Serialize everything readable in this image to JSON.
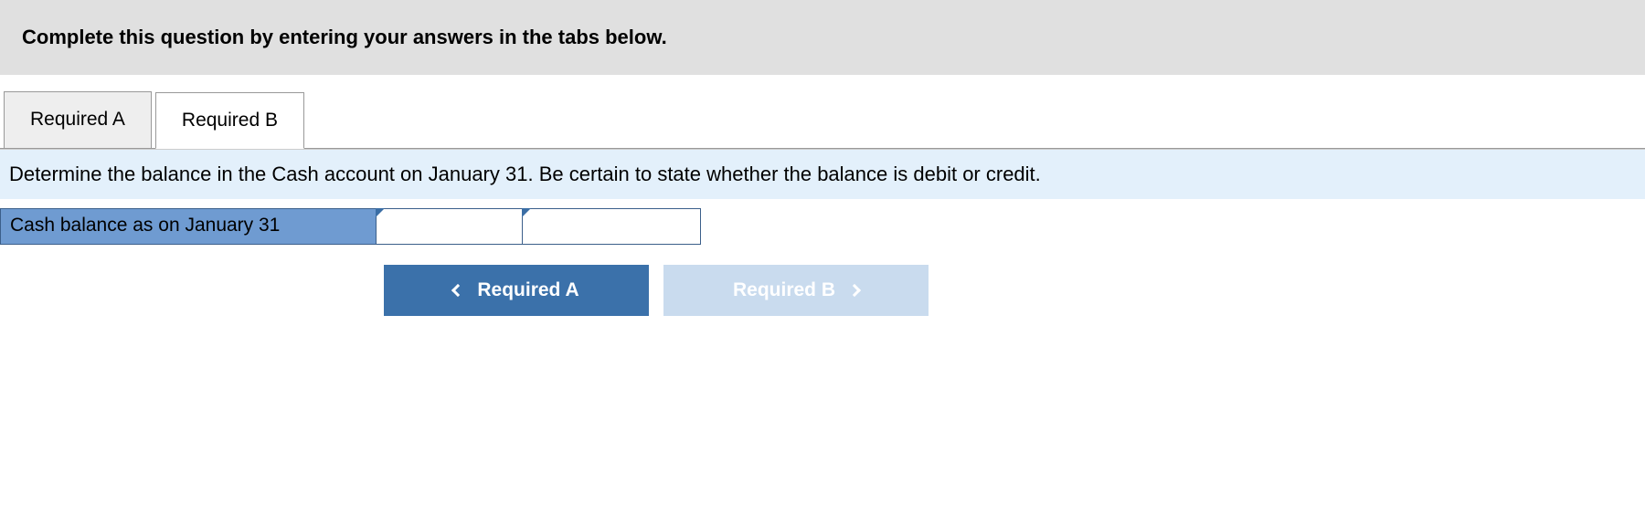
{
  "instruction": "Complete this question by entering your answers in the tabs below.",
  "tabs": [
    {
      "label": "Required A",
      "active": false
    },
    {
      "label": "Required B",
      "active": true
    }
  ],
  "question": "Determine the balance in the Cash account on January 31. Be certain to state whether the balance is debit or credit.",
  "answer_row": {
    "label": "Cash balance as on January 31",
    "input1_value": "",
    "input2_value": ""
  },
  "nav": {
    "prev_label": "Required A",
    "next_label": "Required B"
  }
}
